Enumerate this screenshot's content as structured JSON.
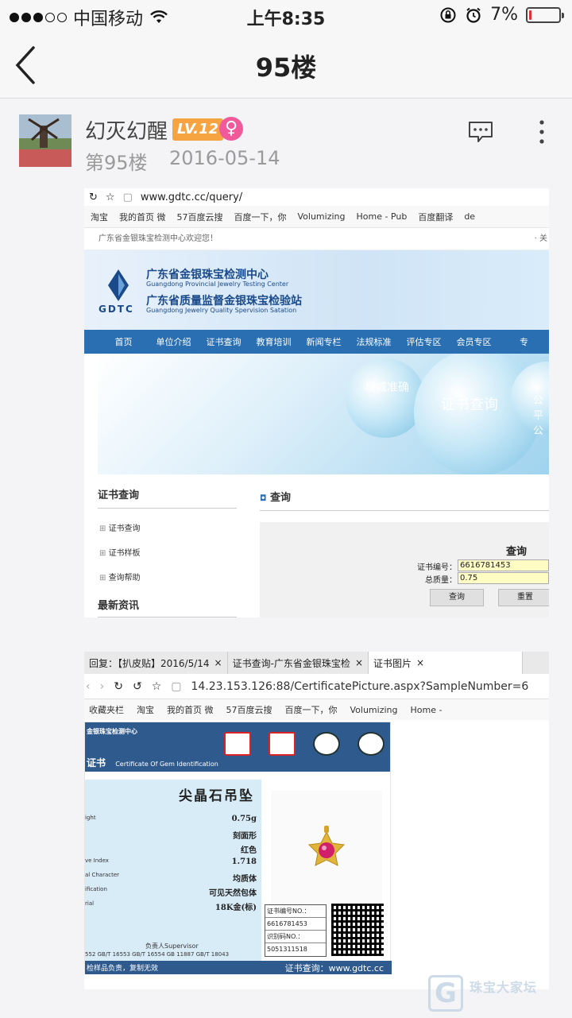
{
  "status_bar": {
    "carrier": "中国移动",
    "time": "上午8:35",
    "battery": "7%",
    "battery_level": 0.07,
    "signal_filled": 3,
    "signal_total": 5
  },
  "nav": {
    "title": "95楼"
  },
  "post": {
    "username": "幻灭幻醒",
    "level": "LV.12",
    "gender_symbol": "♀",
    "floor": "第95楼",
    "date": "2016-05-14"
  },
  "shot1": {
    "url": "www.gdtc.cc/query/",
    "bookmarks": [
      "淘宝",
      "我的首页 微",
      "57百度云搜",
      "百度一下，你",
      "Volumizing",
      "Home - Pub",
      "百度翻译",
      "de"
    ],
    "welcome": "广东省金银珠宝检测中心欢迎您！",
    "welcome_right": "· 关",
    "logo_text": "GDTC",
    "org_cn_1": "广东省金银珠宝检测中心",
    "org_en_1": "Guangdong Provincial Jewelry Testing Center",
    "org_cn_2": "广东省质量监督金银珠宝检验站",
    "org_en_2": "Guangdong Jewelry Quality Spervision Satation",
    "menu": [
      "首页",
      "单位介绍",
      "证书查询",
      "教育培训",
      "新闻专栏",
      "法规标准",
      "评估专区",
      "会员专区",
      "专"
    ],
    "hero": {
      "t1": "权威准确",
      "t2": "证书查询",
      "t3": "公平公"
    },
    "sidebar_title": "证书查询",
    "sidebar_items": [
      "证书查询",
      "证书样板",
      "查询帮助"
    ],
    "sidebar_title_2": "最新资讯",
    "main_title": "查询",
    "form": {
      "heading": "查询",
      "label_cert": "证书编号：",
      "value_cert": "6616781453",
      "label_weight": "总质量：",
      "value_weight": "0.75",
      "btn_query": "查询",
      "btn_reset": "重置"
    }
  },
  "shot2": {
    "tabs": [
      "回复：【扒皮贴】2016/5/14",
      "证书查询-广东省金银珠宝检",
      "证书图片"
    ],
    "url": "14.23.153.126:88/CertificatePicture.aspx?SampleNumber=6",
    "bookmarks": [
      "收藏夹栏",
      "淘宝",
      "我的首页 微",
      "57百度云搜",
      "百度一下，你",
      "Volumizing",
      "Home -"
    ],
    "cert": {
      "head_line1": "金银珠宝检测中心",
      "head_title": "证书",
      "head_title_en": "Certificate Of Gem Identification",
      "item_name": "尖晶石吊坠",
      "rows": [
        {
          "k": "ight",
          "v": "0.75g"
        },
        {
          "k": "",
          "v": "刻面形"
        },
        {
          "k": "",
          "v": "红色"
        },
        {
          "k": "ve Index",
          "v": "1.718"
        },
        {
          "k": "al Character",
          "v": "均质体"
        },
        {
          "k": "ification",
          "v": "可见天然包体"
        },
        {
          "k": "rial",
          "v": "18K金(标)"
        }
      ],
      "cert_no_label": "证书编号NO.：",
      "cert_no": "6616781453",
      "id_label": "识别码NO.：",
      "id_no": "5051311518",
      "supervisor": "负责人Supervisor",
      "standards": "552   GB/T 16553   GB/T 16554   GB 11887   GB/T 18043",
      "foot_left": "检样品负责，复制无效",
      "foot_right": "证书查询：www.gdtc.cc"
    }
  },
  "watermark": {
    "g": "G",
    "text": "珠宝大家坛"
  }
}
